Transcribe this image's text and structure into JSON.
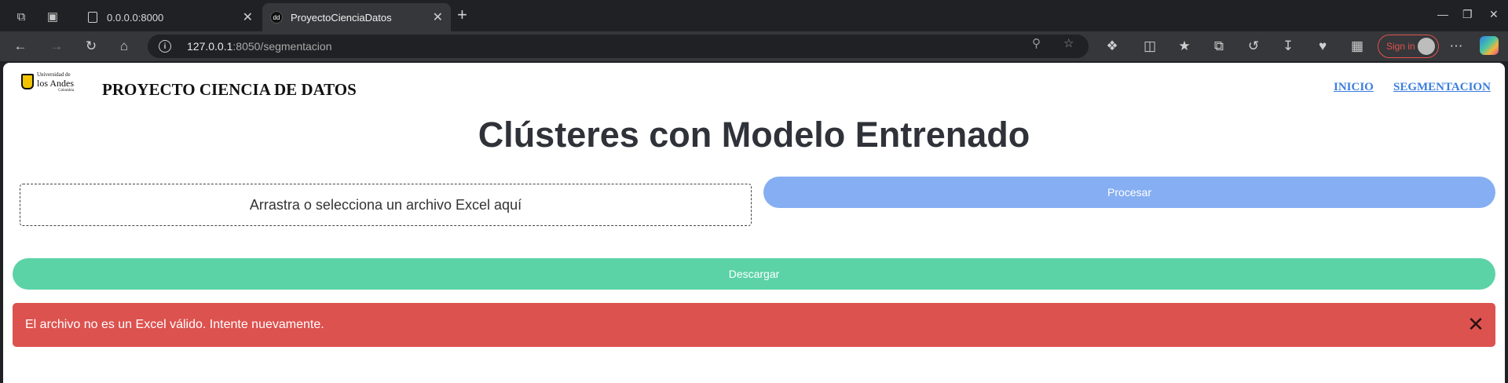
{
  "browser": {
    "tabs": [
      {
        "title": "0.0.0.0:8000",
        "active": false
      },
      {
        "title": "ProyectoCienciaDatos",
        "active": true
      }
    ],
    "active_favicon_text": "dd",
    "url_host": "127.0.0.1",
    "url_path": ":8050/segmentacion",
    "signin_label": "Sign in",
    "icons": {
      "workspaces": "workspaces-icon",
      "tab_actions": "tab-actions-icon",
      "back": "back-arrow-icon",
      "forward": "forward-arrow-icon",
      "refresh": "refresh-icon",
      "home": "home-icon"
    }
  },
  "page": {
    "logo": {
      "line1": "Universidad de",
      "line2": "los Andes",
      "line3": "Colombia"
    },
    "site_title": "PROYECTO CIENCIA DE DATOS",
    "nav": {
      "inicio": "INICIO",
      "segmentacion": "SEGMENTACION"
    },
    "heading": "Clústeres con Modelo Entrenado",
    "upload_text": "Arrastra o selecciona un archivo Excel aquí",
    "process_button": "Procesar",
    "download_button": "Descargar",
    "alert_message": "El archivo no es un Excel válido. Intente nuevamente.",
    "colors": {
      "process": "#86aef2",
      "download": "#5bd3a6",
      "alert": "#dc524f",
      "link": "#3b7ddd"
    }
  }
}
